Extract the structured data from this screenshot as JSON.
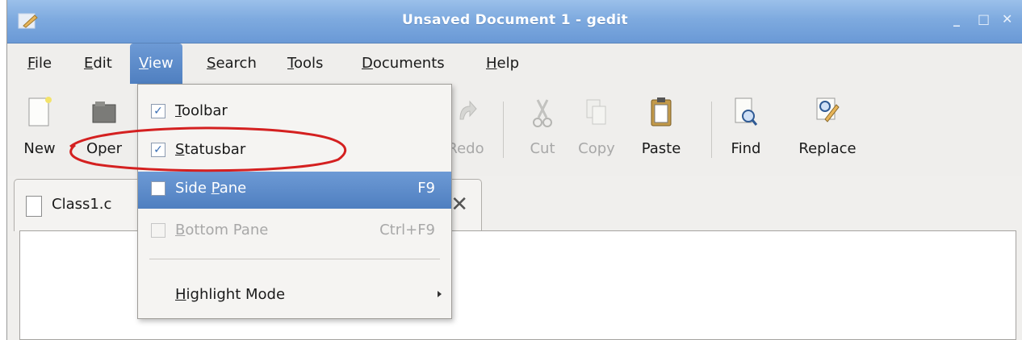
{
  "window": {
    "title": "Unsaved Document 1 - gedit",
    "minimize": "_",
    "maximize": "□",
    "close": "✕"
  },
  "menubar": [
    {
      "label": "File",
      "mn": "F",
      "rest": "ile"
    },
    {
      "label": "Edit",
      "mn": "E",
      "rest": "dit"
    },
    {
      "label": "View",
      "mn": "V",
      "rest": "iew"
    },
    {
      "label": "Search",
      "mn": "S",
      "rest": "earch"
    },
    {
      "label": "Tools",
      "mn": "T",
      "rest": "ools"
    },
    {
      "label": "Documents",
      "mn": "D",
      "rest": "ocuments"
    },
    {
      "label": "Help",
      "mn": "H",
      "rest": "elp"
    }
  ],
  "toolbar": {
    "new": "New",
    "open": "Oper",
    "redo": "Redo",
    "cut": "Cut",
    "copy": "Copy",
    "paste": "Paste",
    "find": "Find",
    "replace": "Replace"
  },
  "tab": {
    "label": "Class1.c",
    "close": "✕"
  },
  "view_menu": {
    "toolbar": {
      "mn": "T",
      "rest": "oolbar",
      "checked": true
    },
    "statusbar": {
      "mn": "S",
      "rest": "tatusbar",
      "checked": true
    },
    "side_pane": {
      "pre": "Side ",
      "mn": "P",
      "rest": "ane",
      "accel": "F9",
      "checked": false
    },
    "bottom_pane": {
      "mn": "B",
      "rest": "ottom Pane",
      "accel": "Ctrl+F9",
      "checked": false
    },
    "highlight_mode": {
      "mn": "H",
      "rest": "ighlight Mode"
    },
    "check_mark": "✓"
  },
  "colors": {
    "highlight": "#5b8ccc",
    "annotation": "#d42020",
    "titlebar": "#7eaadf"
  }
}
